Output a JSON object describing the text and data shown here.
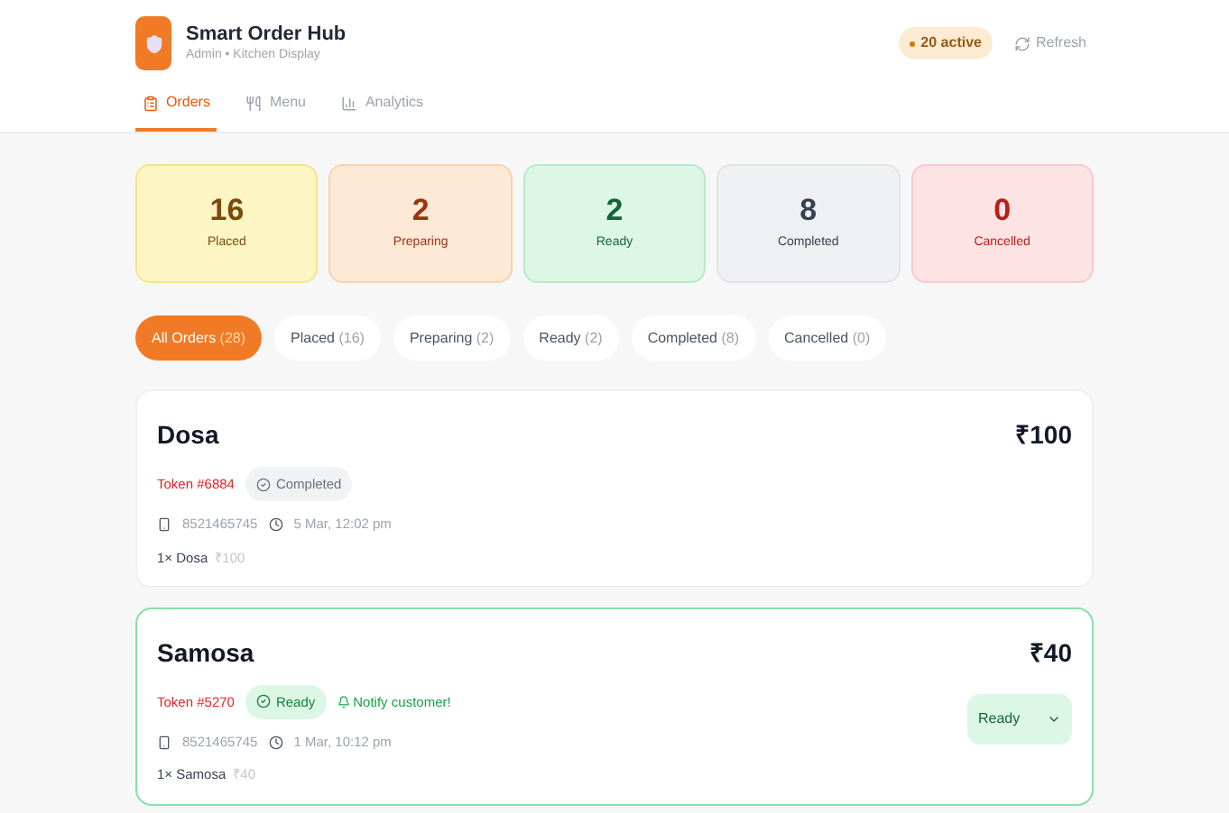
{
  "app": {
    "title": "Smart Order Hub",
    "subtitle": "Admin • Kitchen Display"
  },
  "header": {
    "active_badge": "20 active",
    "refresh": "Refresh"
  },
  "tabs": [
    {
      "label": "Orders",
      "kind": "orders",
      "selected": true
    },
    {
      "label": "Menu",
      "kind": "menu",
      "selected": false
    },
    {
      "label": "Analytics",
      "kind": "analytics",
      "selected": false
    }
  ],
  "stats": [
    {
      "value": "16",
      "label": "Placed",
      "kind": "placed"
    },
    {
      "value": "2",
      "label": "Preparing",
      "kind": "preparing"
    },
    {
      "value": "2",
      "label": "Ready",
      "kind": "ready"
    },
    {
      "value": "8",
      "label": "Completed",
      "kind": "completed"
    },
    {
      "value": "0",
      "label": "Cancelled",
      "kind": "cancelled"
    }
  ],
  "filters": [
    {
      "label": "All Orders",
      "count": "(28)",
      "selected": true
    },
    {
      "label": "Placed",
      "count": "(16)",
      "selected": false
    },
    {
      "label": "Preparing",
      "count": "(2)",
      "selected": false
    },
    {
      "label": "Ready",
      "count": "(2)",
      "selected": false
    },
    {
      "label": "Completed",
      "count": "(8)",
      "selected": false
    },
    {
      "label": "Cancelled",
      "count": "(0)",
      "selected": false
    }
  ],
  "orders": [
    {
      "name": "Dosa",
      "token": "Token #6884",
      "status": {
        "kind": "completed",
        "label": "Completed"
      },
      "phone": "8521465745",
      "time": "5 Mar, 12:02 pm",
      "items": [
        {
          "qty_name": "1× Dosa",
          "price": "₹100"
        }
      ],
      "total": "₹100",
      "highlighted": false
    },
    {
      "name": "Samosa",
      "token": "Token #5270",
      "status": {
        "kind": "ready",
        "label": "Ready"
      },
      "notify": "Notify customer!",
      "phone": "8521465745",
      "time": "1 Mar, 10:12 pm",
      "items": [
        {
          "qty_name": "1× Samosa",
          "price": "₹40"
        }
      ],
      "total": "₹40",
      "dropdown": "Ready",
      "highlighted": true
    }
  ]
}
